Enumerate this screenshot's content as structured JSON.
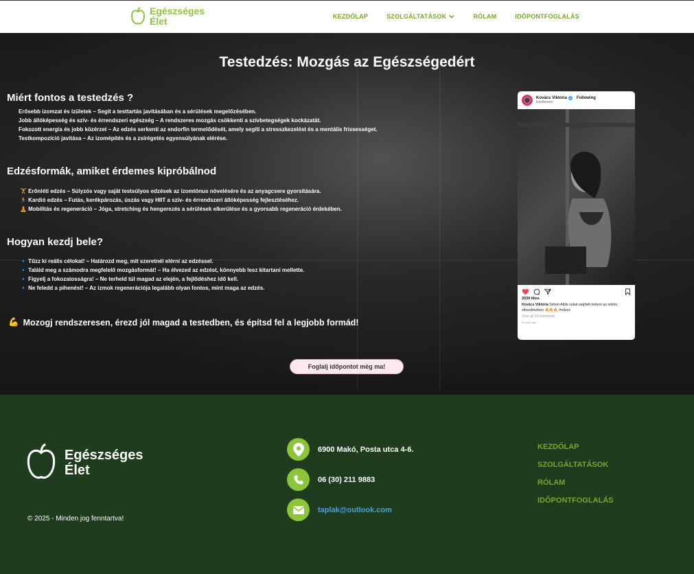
{
  "header": {
    "logo_line1": "Egészséges",
    "logo_line2": "Élet",
    "nav": [
      "KEZDŐLAP",
      "SZOLGÁLTATÁSOK",
      "RÓLAM",
      "IDŐPONTFOGLALÁS"
    ]
  },
  "hero": {
    "title": "Testedzés: Mozgás az Egészségedért",
    "section1": {
      "heading": "Miért fontos a testedzés ?",
      "items": [
        "Erősebb izomzat és ízületek – Segít a testtartás javításában és a sérülések megelőzésében.",
        "Jobb állóképesség és szív- és érrendszeri egészség – A rendszeres mozgás csökkenti a szívbetegségek kockázatát.",
        "Fokozott energia és jobb közérzet – Az edzés serkenti az endorfin termelődését, amely segíti a stresszkezelést és a mentális frissességet.",
        "Testkompozíció javítása – Az izomépítés és a zsírégetés egyensúlyának elérése."
      ]
    },
    "section2": {
      "heading": "Edzésformák, amiket érdemes kipróbálnod",
      "items": [
        "🏋️ Erőnléti edzés – Súlyzós vagy saját testsúlyos edzések az izomtónus növelésére és az anyagcsere gyorsítására.",
        "🏃 Kardió edzés – Futás, kerékpározás, úszás vagy HIIT a szív- és érrendszeri állóképesség fejlesztéséhez.",
        "🧘 Mobilitás és regeneráció – Jóga, stretching és hengerezés a sérülések elkerülése és a gyorsabb regeneráció érdekében."
      ]
    },
    "section3": {
      "heading": "Hogyan kezdj bele?",
      "items": [
        "🔹 Tűzz ki reális célokat! – Határozd meg, mit szeretnél elérni az edzéssel.",
        "🔹 Találd meg a számodra megfelelő mozgásformát! – Ha élvezed az edzést, könnyebb lesz kitartani mellette.",
        "🔹 Figyelj a fokozatosságra! – Ne terheld túl magad az elején, a fejlődéshez idő kell.",
        "🔹 Ne feledd a pihenést! – Az izmok regenerációja legalább olyan fontos, mint maga az edzés."
      ]
    },
    "motto_emoji": "💪",
    "motto": "Mozogj rendszeresen, érezd jól magad a testedben, és építsd fel a legjobb formád!",
    "cta": "Foglalj időpontot még ma!"
  },
  "instagram": {
    "username": "Kovács Viktória",
    "follow": "Following",
    "location": "Edzőterem",
    "likes": "2039 likes",
    "caption_user": "Kovács Viktória",
    "caption": "Simon Attila sokat segített nekem az edzés elkezdésében 🔥🔥🔥 #edzes",
    "comments": "View all 16 comments",
    "time": "8 hours ago"
  },
  "footer": {
    "logo_line1": "Egészséges",
    "logo_line2": "Élet",
    "copyright": "© 2025 - Minden jog fenntartva!",
    "address": "6900 Makó, Posta utca 4-6.",
    "phone": "06 (30) 211 9883",
    "email": "taplak@outlook.com",
    "links": [
      "KEZDŐLAP",
      "SZOLGÁLTATÁSOK",
      "RÓLAM",
      "IDŐPONTFOGLALÁS"
    ]
  },
  "colors": {
    "brand_green": "#8cc43a",
    "nav_green": "#7aa52a",
    "footer_bg": "#1f3d1e",
    "link_blue": "#4aa0d8"
  }
}
